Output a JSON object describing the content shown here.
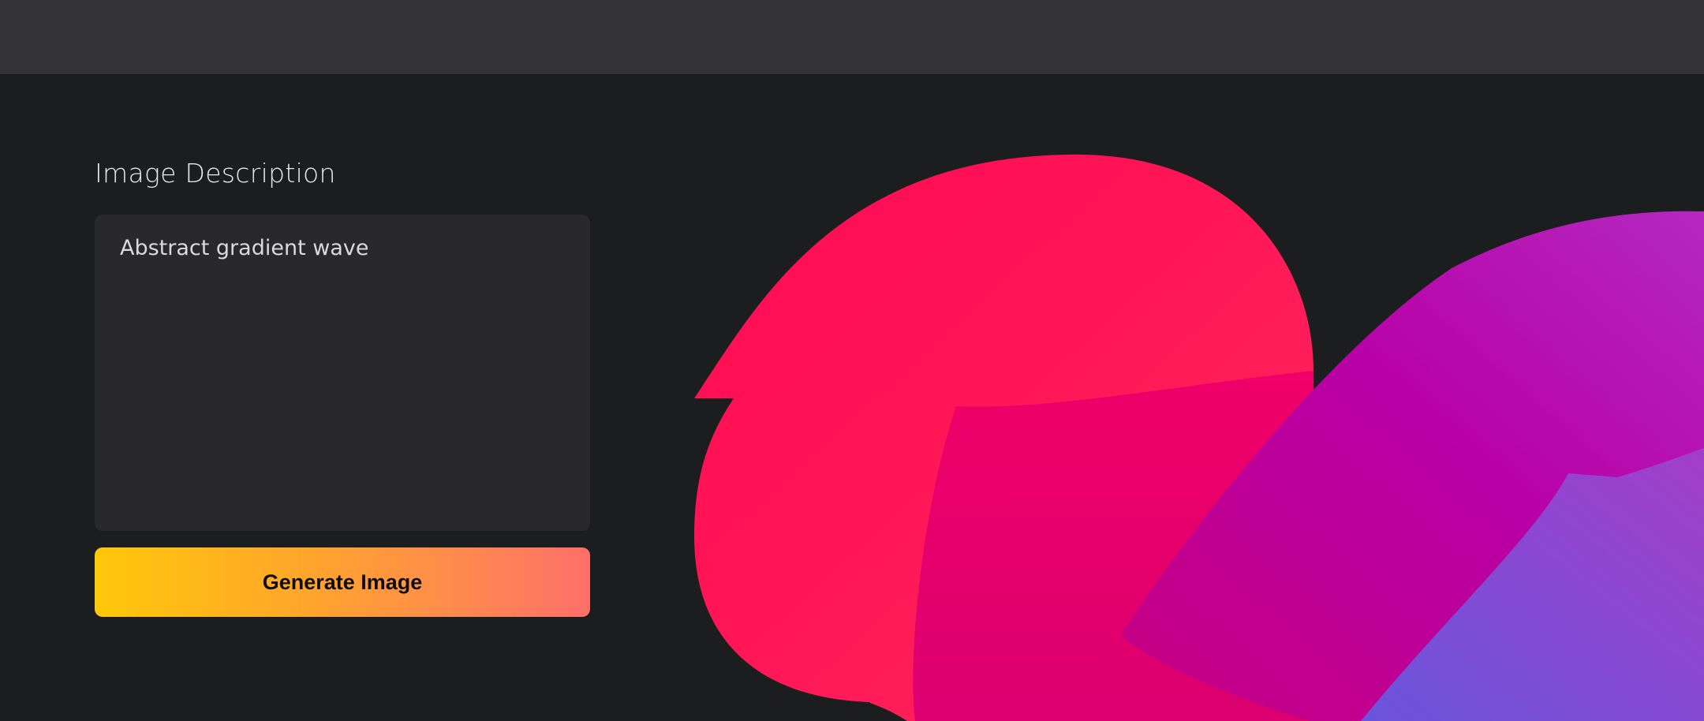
{
  "form": {
    "label": "Image Description",
    "description_value": "Abstract gradient wave",
    "generate_label": "Generate Image"
  },
  "artwork": {
    "colors": {
      "pink": "#ff1e5a",
      "magenta": "#f0006e",
      "purple": "#b400aa",
      "violet": "#7055e0"
    }
  }
}
